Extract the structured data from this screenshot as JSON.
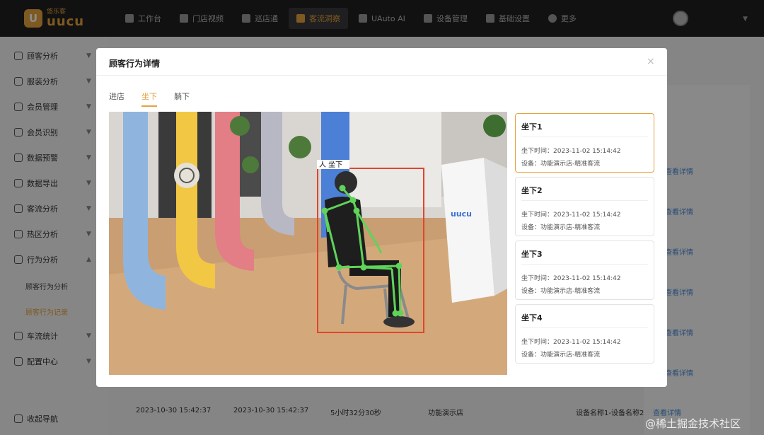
{
  "topbar": {
    "logo_cn": "悠乐客",
    "logo_en": "uucu",
    "nav": [
      {
        "label": "工作台",
        "icon": "home-icon"
      },
      {
        "label": "门店视频",
        "icon": "video-icon"
      },
      {
        "label": "巡店通",
        "icon": "checklist-icon"
      },
      {
        "label": "客流洞察",
        "icon": "people-icon",
        "active": true
      },
      {
        "label": "UAuto AI",
        "icon": "ai-icon"
      },
      {
        "label": "设备管理",
        "icon": "device-icon"
      },
      {
        "label": "基础设置",
        "icon": "settings-icon"
      },
      {
        "label": "更多",
        "icon": "more-icon"
      }
    ]
  },
  "sidebar": {
    "items": [
      {
        "label": "顾客分析"
      },
      {
        "label": "服装分析"
      },
      {
        "label": "会员管理"
      },
      {
        "label": "会员识别"
      },
      {
        "label": "数据预警"
      },
      {
        "label": "数据导出"
      },
      {
        "label": "客流分析"
      },
      {
        "label": "热区分析"
      },
      {
        "label": "行为分析"
      },
      {
        "label": "车流统计"
      },
      {
        "label": "配置中心"
      }
    ],
    "sub_items": [
      {
        "label": "顾客行为分析"
      },
      {
        "label": "顾客行为记录"
      }
    ],
    "footer": "收起导航"
  },
  "background": {
    "link_label": "查看详情",
    "row": {
      "start": "2023-10-30 15:42:37",
      "end": "2023-10-30 15:42:37",
      "duration": "5小时32分30秒",
      "store": "功能演示店",
      "device": "设备名称1-设备名称2",
      "action": "查看详情"
    }
  },
  "modal": {
    "title": "顾客行为详情",
    "close": "×",
    "tabs": [
      "进店",
      "坐下",
      "躺下"
    ],
    "active_tab": 1,
    "detection_label": "人 坐下",
    "events": [
      {
        "title": "坐下1",
        "time": "坐下时间：2023-11-02 15:14:42",
        "device": "设备：功能演示店-精准客流"
      },
      {
        "title": "坐下2",
        "time": "坐下时间：2023-11-02 15:14:42",
        "device": "设备：功能演示店-精准客流"
      },
      {
        "title": "坐下3",
        "time": "坐下时间：2023-11-02 15:14:42",
        "device": "设备：功能演示店-精准客流"
      },
      {
        "title": "坐下4",
        "time": "坐下时间：2023-11-02 15:14:42",
        "device": "设备：功能演示店-精准客流"
      }
    ]
  },
  "watermark": "@稀土掘金技术社区",
  "colors": {
    "accent": "#e6a23c",
    "topbar": "#1f1f21",
    "detect_box": "#e0452c",
    "skeleton": "#5fd35a"
  }
}
